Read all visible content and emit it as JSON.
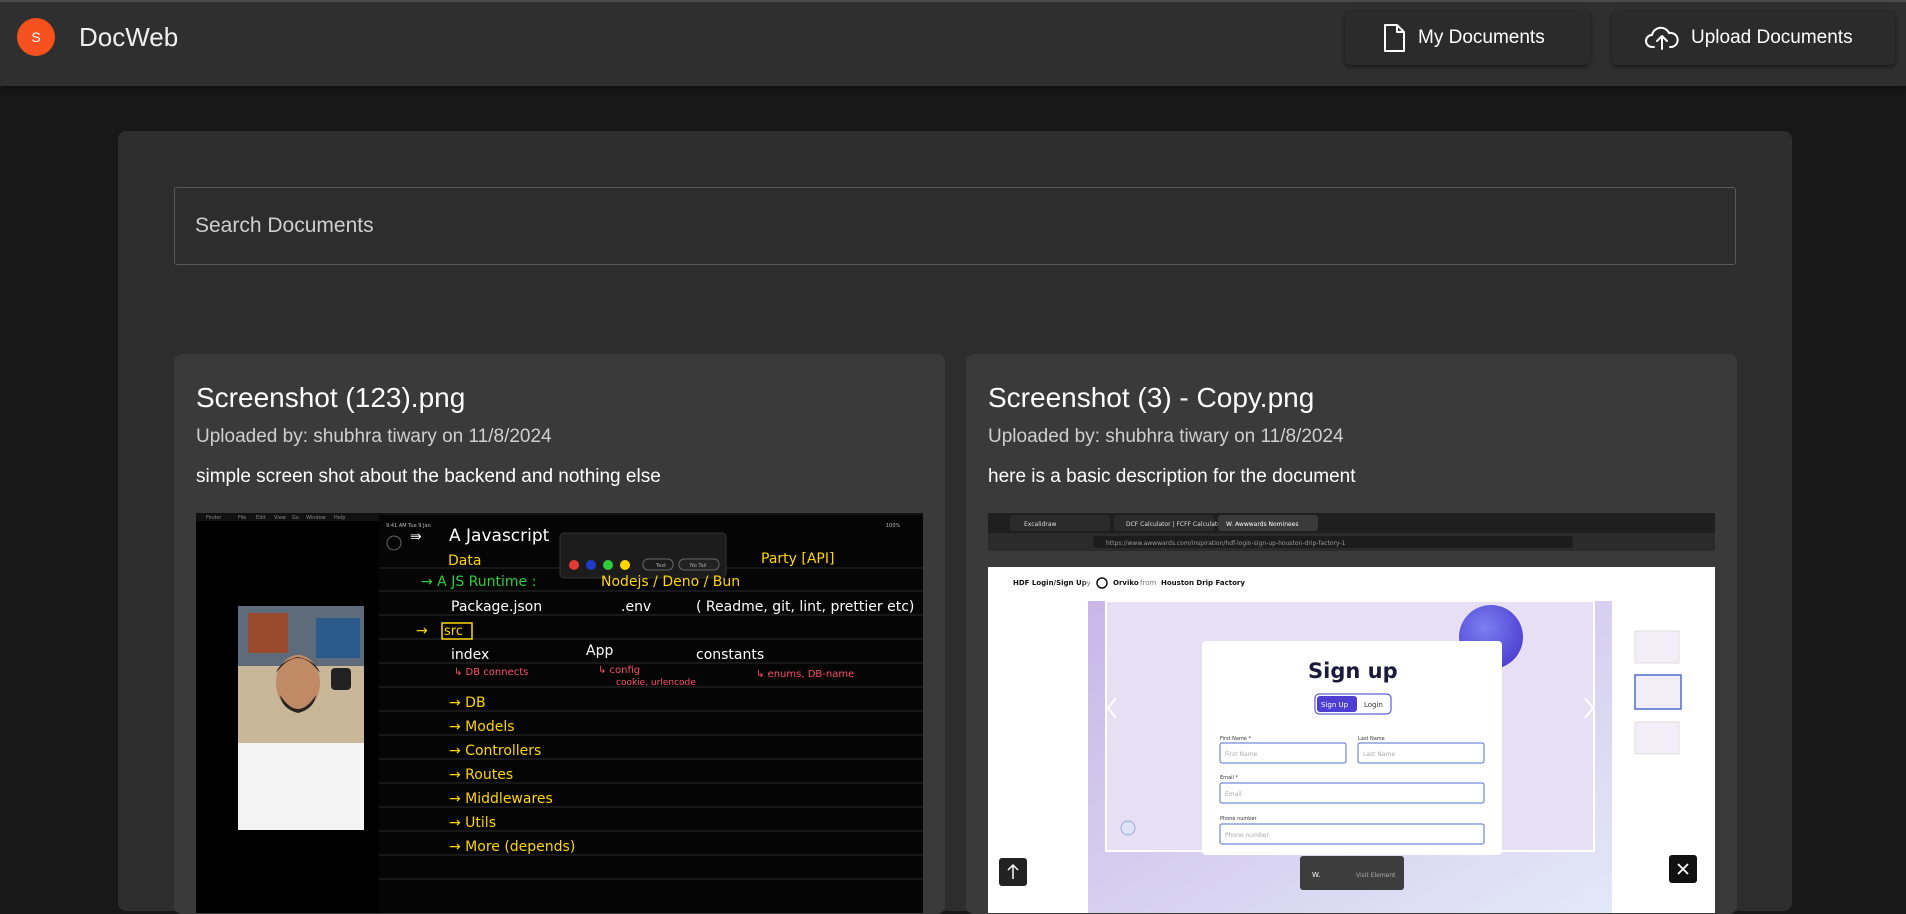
{
  "header": {
    "avatar_letter": "S",
    "avatar_color": "#f4511e",
    "app_name": "DocWeb",
    "my_documents_label": "My Documents",
    "my_documents_icon": "document-icon",
    "upload_documents_label": "Upload Documents",
    "upload_documents_icon": "cloud-upload-icon"
  },
  "search": {
    "placeholder": "Search Documents"
  },
  "documents": [
    {
      "title": "Screenshot (123).png",
      "uploaded": "Uploaded by: shubhra tiwary on 11/8/2024",
      "description": "simple screen shot about the backend and nothing else",
      "preview": {
        "menu": [
          "Finder",
          "File",
          "Edit",
          "View",
          "Go",
          "Window",
          "Help"
        ],
        "status_time": "9:41 AM   Tue 9 Jan",
        "status_battery": "100%",
        "notes": [
          "⇛",
          "A  Javascript",
          "Party  [API]",
          "Data",
          "→  A  JS  Runtime :",
          "Nodejs  / Deno / Bun",
          "Package.json",
          ".env",
          "( Readme, git, lint, prettier etc)",
          "→",
          "src",
          "index",
          "App",
          "constants",
          "↳ DB connects",
          "↳ config",
          "cookie, urlencode",
          "↳ enums, DB-name",
          "→   DB",
          "→   Models",
          "→   Controllers",
          "→   Routes",
          "→   Middlewares",
          "→   Utils",
          "→   More (depends)"
        ],
        "toolbar_text": [
          "Text",
          "No Tail"
        ]
      }
    },
    {
      "title": "Screenshot (3) - Copy.png",
      "uploaded": "Uploaded by: shubhra tiwary on 11/8/2024",
      "description": "here is a basic description for the document",
      "preview": {
        "tabs": [
          "Excalidraw",
          "DCF Calculator | FCFF Calculator",
          "W.  Awwwards Nominees"
        ],
        "url": "https://www.awwwards.com/inspiration/hdf-login-sign-up-houston-drip-factory-1",
        "page_title": "HDF Login/Sign Up",
        "by": "by",
        "author": "Orviko",
        "from": "from",
        "studio": "Houston Drip Factory",
        "form_heading": "Sign up",
        "signup_btn": "Sign Up",
        "login_btn": "Login",
        "first_name_label": "First Name *",
        "first_name_placeholder": "First Name",
        "last_name_label": "Last Name",
        "last_name_placeholder": "Last Name",
        "email_label": "Email *",
        "email_placeholder": "Email",
        "phone_label": "Phone number",
        "phone_placeholder": "Phone number",
        "bottom_bar_w": "W.",
        "bottom_bar_text": "Visit Element"
      }
    }
  ]
}
